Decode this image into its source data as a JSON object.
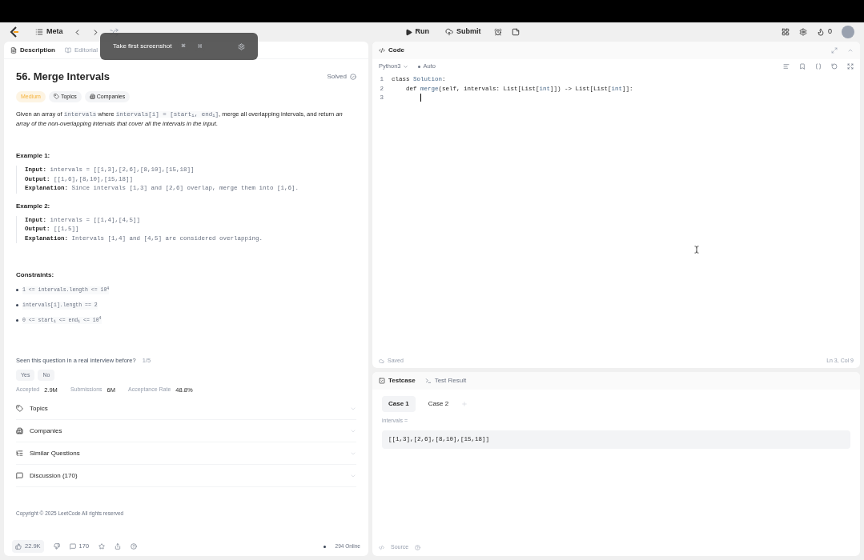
{
  "topbar": {
    "list_name": "Meta",
    "run": "Run",
    "submit": "Submit",
    "streak": "0"
  },
  "toast": {
    "text": "Take first screenshot",
    "keys": [
      "⌘",
      "H"
    ]
  },
  "left_tabs": [
    {
      "label": "Description",
      "selected": true
    },
    {
      "label": "Editorial",
      "selected": false
    }
  ],
  "problem": {
    "title": "56. Merge Intervals",
    "status": "Solved",
    "difficulty": "Medium",
    "tags": [
      "Topics",
      "Companies"
    ],
    "description": [
      {
        "kind": "text",
        "text": "Given an array of "
      },
      {
        "kind": "code",
        "text": "intervals"
      },
      {
        "kind": "text",
        "text": " where "
      },
      {
        "kind": "code",
        "text": "intervals[i] = [start$_{i}$, end$_{i}$]"
      },
      {
        "kind": "text",
        "text": ", merge all overlapping intervals, and return "
      },
      {
        "kind": "italic",
        "text": "an array of the non-overlapping intervals that cover all the intervals in the input"
      },
      {
        "kind": "text",
        "text": "."
      }
    ],
    "examples": [
      {
        "title": "Example 1:",
        "lines": [
          {
            "label": "Input:",
            "value": "intervals = [[1,3],[2,6],[8,10],[15,18]]"
          },
          {
            "label": "Output:",
            "value": "[[1,6],[8,10],[15,18]]"
          },
          {
            "label": "Explanation:",
            "value": "Since intervals [1,3] and [2,6] overlap, merge them into [1,6]."
          }
        ]
      },
      {
        "title": "Example 2:",
        "lines": [
          {
            "label": "Input:",
            "value": "intervals = [[1,4],[4,5]]"
          },
          {
            "label": "Output:",
            "value": "[[1,5]]"
          },
          {
            "label": "Explanation:",
            "value": "Intervals [1,4] and [4,5] are considered overlapping."
          }
        ]
      }
    ],
    "constraints_title": "Constraints:",
    "constraints": [
      "1 <= intervals.length <= 10$^{4}$",
      "intervals[i].length == 2",
      "0 <= start$_{i}$ <= end$_{i}$ <= 10$^{4}$"
    ],
    "interview_question": "Seen this question in a real interview before?",
    "interview_count": "1/5",
    "answers": [
      "Yes",
      "No"
    ],
    "stats": [
      {
        "label": "Accepted",
        "value": "2.9M"
      },
      {
        "label": "Submissions",
        "value": "6M"
      },
      {
        "label": "Acceptance Rate",
        "value": "48.8%"
      }
    ],
    "sections": [
      {
        "kind": "topics",
        "label": "Topics",
        "expanded": false
      },
      {
        "kind": "companies",
        "label": "Companies",
        "expanded": false
      },
      {
        "kind": "similar",
        "label": "Similar Questions",
        "expanded": false
      },
      {
        "kind": "discussion",
        "label": "Discussion (170)",
        "expanded": false
      }
    ],
    "copyright": "Copyright © 2025 LeetCode All rights reserved"
  },
  "footer": {
    "likes": "22.9K",
    "comments": "170",
    "online": "294 Online"
  },
  "code_panel": {
    "title": "Code",
    "language": "Python3",
    "mode": "Auto",
    "lines": [
      {
        "number": "1",
        "tokens": [
          {
            "kind": "plain",
            "text": "class "
          },
          {
            "kind": "type",
            "text": "Solution"
          },
          {
            "kind": "plain",
            "text": ":"
          }
        ]
      },
      {
        "number": "2",
        "tokens": [
          {
            "kind": "plain",
            "text": "    def "
          },
          {
            "kind": "type",
            "text": "merge"
          },
          {
            "kind": "plain",
            "text": "(self, intervals: List[List["
          },
          {
            "kind": "type",
            "text": "int"
          },
          {
            "kind": "plain",
            "text": "]]) -> List[List["
          },
          {
            "kind": "type",
            "text": "int"
          },
          {
            "kind": "plain",
            "text": "]]:"
          }
        ]
      },
      {
        "number": "3",
        "cursor": true
      }
    ],
    "saved": "Saved",
    "position": "Ln 3, Col 9"
  },
  "test_panel": {
    "tabs": [
      {
        "label": "Testcase",
        "selected": true
      },
      {
        "label": "Test Result",
        "selected": false
      }
    ],
    "cases": [
      {
        "label": "Case 1",
        "selected": true
      },
      {
        "label": "Case 2",
        "selected": false
      }
    ],
    "param_label": "intervals =",
    "param_value": "[[1,3],[2,6],[8,10],[15,18]]",
    "source": "Source"
  }
}
